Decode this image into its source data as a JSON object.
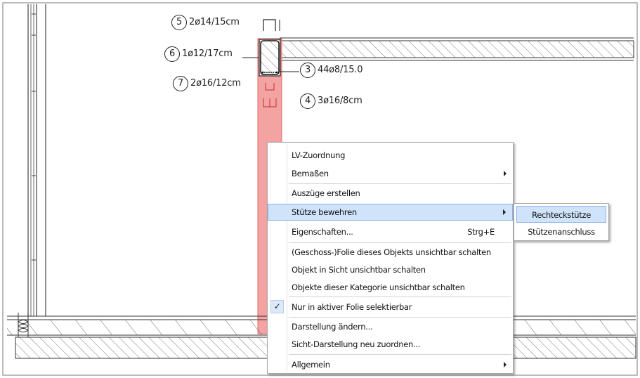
{
  "annotations": [
    {
      "num": "5",
      "text": "2ø14/15cm"
    },
    {
      "num": "6",
      "text": "1ø12/17cm"
    },
    {
      "num": "7",
      "text": "2ø16/12cm"
    },
    {
      "num": "3",
      "text": "44ø8/15.0"
    },
    {
      "num": "4",
      "text": "3ø16/8cm"
    }
  ],
  "context_menu": {
    "items": [
      {
        "label": "LV-Zuordnung",
        "shortcut": "",
        "submenu": false
      },
      {
        "label": "Bemaßen",
        "shortcut": "",
        "submenu": true
      },
      {
        "label": "Auszüge erstellen",
        "shortcut": "",
        "submenu": false
      },
      {
        "label": "Stütze bewehren",
        "shortcut": "",
        "submenu": true,
        "highlighted": true
      },
      {
        "label": "Eigenschaften...",
        "shortcut": "Strg+E",
        "submenu": false
      },
      {
        "label": "(Geschoss-)Folie dieses Objekts unsichtbar schalten",
        "shortcut": "",
        "submenu": false
      },
      {
        "label": "Objekt in Sicht unsichtbar schalten",
        "shortcut": "",
        "submenu": false
      },
      {
        "label": "Objekte dieser Kategorie unsichtbar schalten",
        "shortcut": "",
        "submenu": false
      },
      {
        "label": "Nur in aktiver Folie selektierbar",
        "shortcut": "",
        "submenu": false,
        "checked": true
      },
      {
        "label": "Darstellung ändern...",
        "shortcut": "",
        "submenu": false
      },
      {
        "label": "Sicht-Darstellung neu zuordnen...",
        "shortcut": "",
        "submenu": false
      },
      {
        "label": "Allgemein",
        "shortcut": "",
        "submenu": true
      }
    ]
  },
  "submenu": {
    "items": [
      {
        "label": "Rechteckstütze",
        "highlighted": true
      },
      {
        "label": "Stützenanschluss",
        "highlighted": false
      }
    ]
  },
  "colors": {
    "column_fill": "#f4a3a3",
    "column_stroke": "#e36a6a",
    "menu_highlight": "#cfe3fb",
    "hatch": "#444444"
  }
}
